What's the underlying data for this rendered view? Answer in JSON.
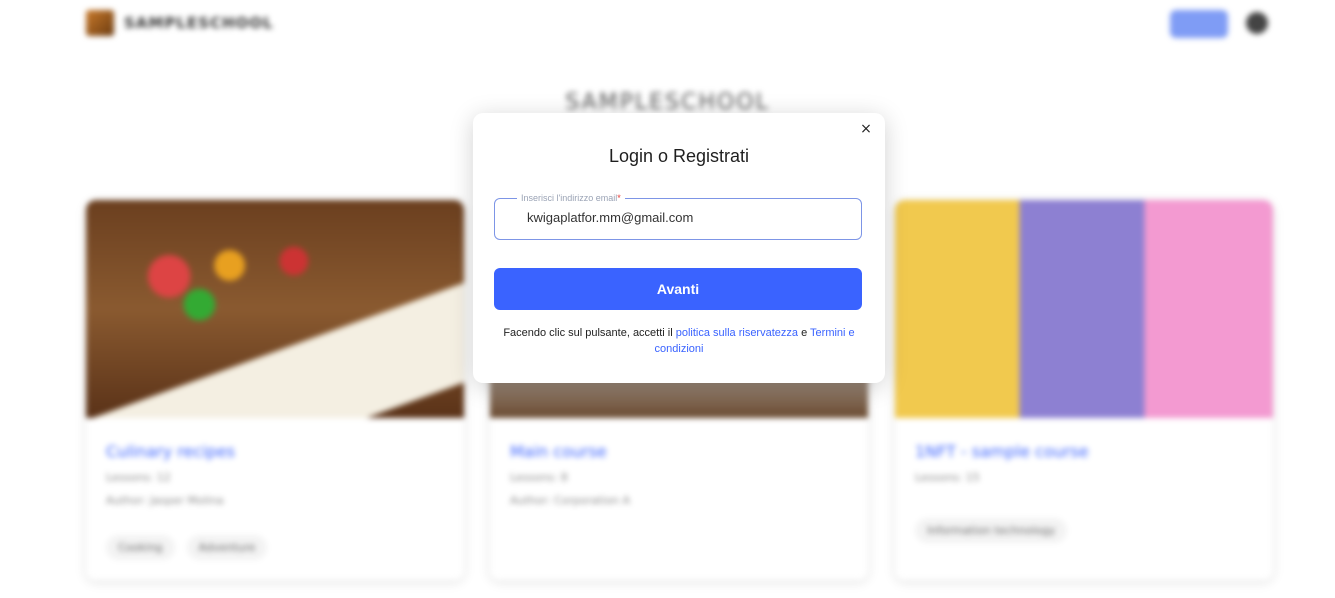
{
  "background": {
    "logo_text": "SAMPLESCHOOL",
    "school_title": "SAMPLESCHOOL",
    "courses": [
      {
        "title": "Culinary recipes",
        "lessons": "Lessons: 12",
        "author": "Author: Jasper Molina",
        "tags": [
          "Cooking",
          "Adventure"
        ]
      },
      {
        "title": "Main course",
        "lessons": "Lessons: 8",
        "author": "Author: Corporation A",
        "tags": []
      },
      {
        "title": "1NFT - sample course",
        "lessons": "Lessons: 15",
        "author": "",
        "tags": [
          "Information technology"
        ]
      }
    ]
  },
  "modal": {
    "title": "Login o Registrati",
    "email_label": "Inserisci l'indirizzo email",
    "email_required_mark": "*",
    "email_value": "kwigaplatfor.mm@gmail.com",
    "submit_label": "Avanti",
    "legal_prefix": "Facendo clic sul pulsante, accetti il ",
    "privacy_link": "politica sulla riservatezza",
    "legal_and": " e ",
    "terms_link": "Termini e condizioni",
    "close_glyph": "×"
  },
  "colors": {
    "accent": "#3a63ff",
    "field_border": "#7d95e6"
  }
}
